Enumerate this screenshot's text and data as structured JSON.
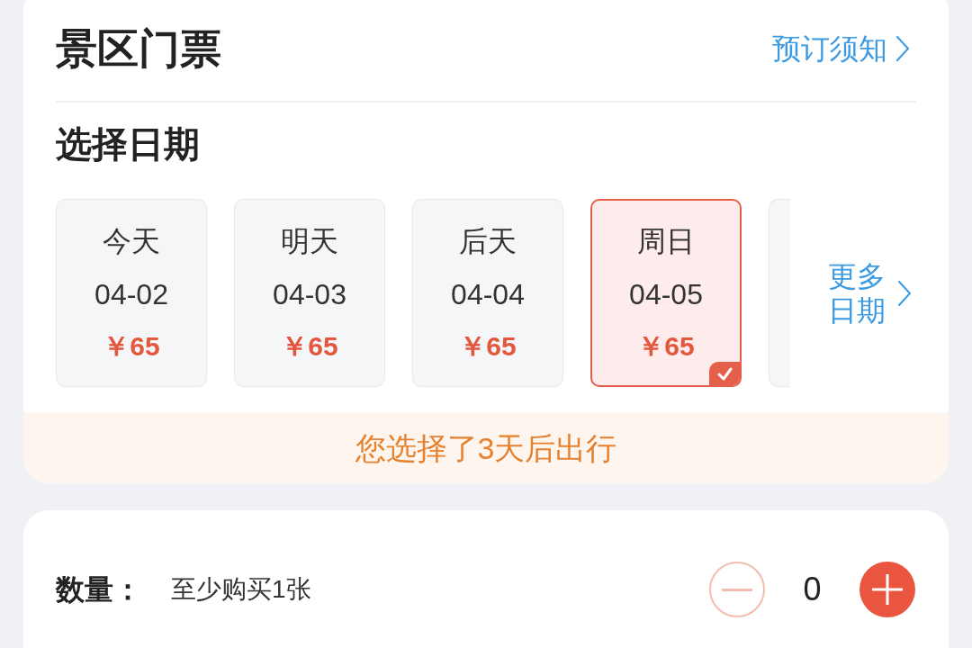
{
  "ticket_card": {
    "title": "景区门票",
    "notice_link": "预订须知",
    "date_section": {
      "heading": "选择日期",
      "dates": [
        {
          "label": "今天",
          "date": "04-02",
          "price": "￥65",
          "selected": false
        },
        {
          "label": "明天",
          "date": "04-03",
          "price": "￥65",
          "selected": false
        },
        {
          "label": "后天",
          "date": "04-04",
          "price": "￥65",
          "selected": false
        },
        {
          "label": "周日",
          "date": "04-05",
          "price": "￥65",
          "selected": true
        }
      ],
      "more_dates": "更多日期"
    },
    "hint": "您选择了3天后出行"
  },
  "quantity": {
    "label": "数量：",
    "hint": "至少购买1张",
    "value": "0",
    "decrease_disabled": true
  }
}
